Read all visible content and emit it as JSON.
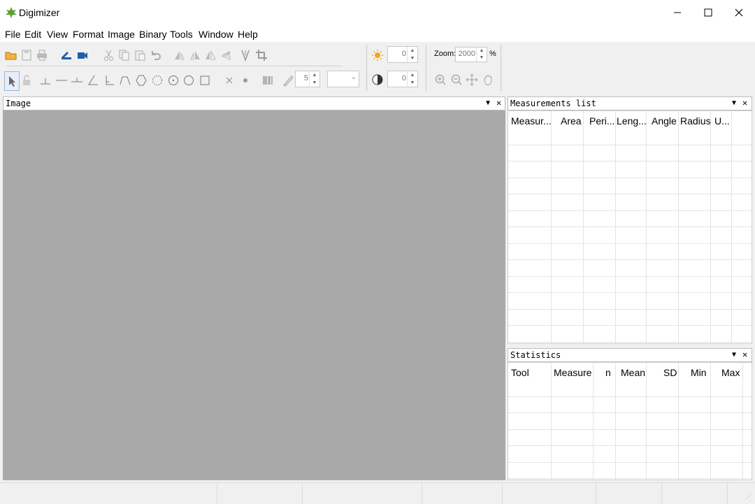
{
  "window": {
    "title": "Digimizer"
  },
  "menu": [
    "File",
    "Edit",
    "View",
    "Format",
    "Image",
    "Binary",
    "Tools",
    "Window",
    "Help"
  ],
  "toolbar": {
    "brightness_value": "0",
    "contrast_value": "0",
    "zoom_label": "Zoom:",
    "zoom_value": "2000",
    "zoom_unit": "%",
    "line_width_value": "5"
  },
  "panels": {
    "image": {
      "title": "Image"
    },
    "measurements": {
      "title": "Measurements list",
      "columns": [
        "Measur...",
        "Area",
        "Peri...",
        "Leng...",
        "Angle",
        "Radius",
        "U..."
      ]
    },
    "statistics": {
      "title": "Statistics",
      "columns": [
        "Tool",
        "Measure",
        "n",
        "Mean",
        "SD",
        "Min",
        "Max"
      ]
    }
  },
  "colors": {
    "canvas": "#a9a9a9",
    "accent_blue": "#1e5fa8",
    "icon_yellow": "#f2a81d"
  }
}
